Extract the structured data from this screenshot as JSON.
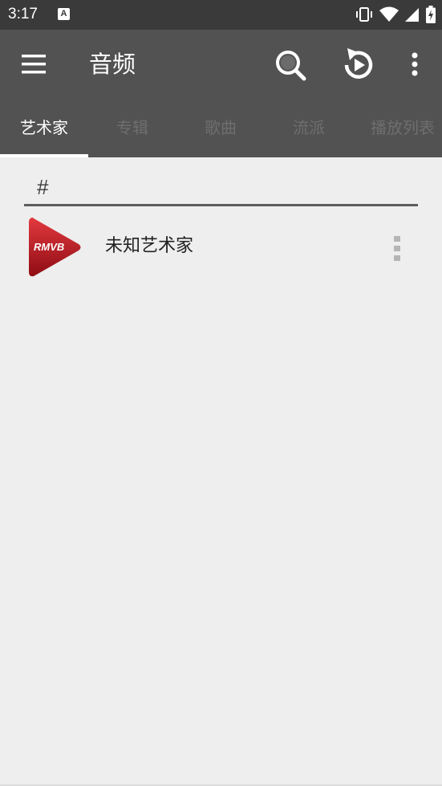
{
  "status_bar": {
    "time": "3:17",
    "notification_icon_letter": "A",
    "icons": [
      "vibrate-icon",
      "wifi-icon",
      "cell-signal-icon",
      "battery-charging-icon"
    ]
  },
  "app_bar": {
    "title": "音频",
    "menu_icon": "hamburger-menu-icon",
    "actions": [
      "search-icon",
      "replay-icon",
      "more-vert-icon"
    ]
  },
  "tabs": [
    {
      "label": "艺术家",
      "active": true
    },
    {
      "label": "专辑",
      "active": false
    },
    {
      "label": "歌曲",
      "active": false
    },
    {
      "label": "流派",
      "active": false
    },
    {
      "label": "播放列表",
      "active": false
    }
  ],
  "section": {
    "label": "#"
  },
  "artists": [
    {
      "name": "未知艺术家",
      "thumb_text": "RMVB"
    }
  ],
  "colors": {
    "app_bar": "#525252",
    "status_bar": "#3a3a3a",
    "background": "#eeeeee",
    "thumb_red": "#b3121d",
    "active_tab": "#ffffff",
    "inactive_tab": "#6e6e6e"
  }
}
